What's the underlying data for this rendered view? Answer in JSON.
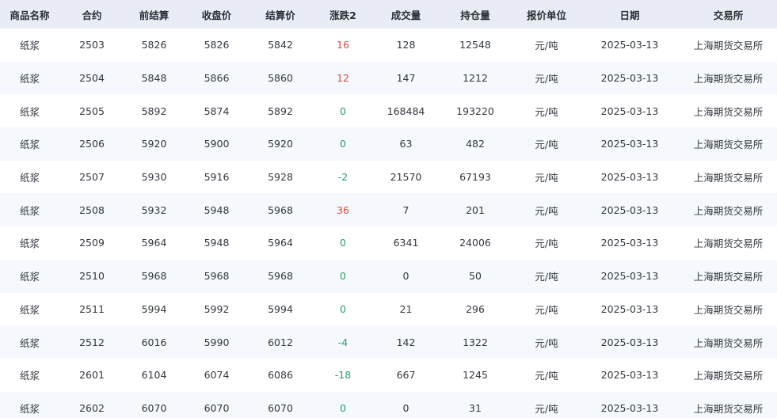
{
  "table": {
    "headers": [
      "商品名称",
      "合约",
      "前结算",
      "收盘价",
      "结算价",
      "涨跌2",
      "成交量",
      "持仓量",
      "报价单位",
      "日期",
      "交易所"
    ],
    "rows": [
      [
        "纸浆",
        "2503",
        "5826",
        "5826",
        "5842",
        "16",
        "128",
        "12548",
        "元/吨",
        "2025-03-13",
        "上海期货交易所"
      ],
      [
        "纸浆",
        "2504",
        "5848",
        "5866",
        "5860",
        "12",
        "147",
        "1212",
        "元/吨",
        "2025-03-13",
        "上海期货交易所"
      ],
      [
        "纸浆",
        "2505",
        "5892",
        "5874",
        "5892",
        "0",
        "168484",
        "193220",
        "元/吨",
        "2025-03-13",
        "上海期货交易所"
      ],
      [
        "纸浆",
        "2506",
        "5920",
        "5900",
        "5920",
        "0",
        "63",
        "482",
        "元/吨",
        "2025-03-13",
        "上海期货交易所"
      ],
      [
        "纸浆",
        "2507",
        "5930",
        "5916",
        "5928",
        "-2",
        "21570",
        "67193",
        "元/吨",
        "2025-03-13",
        "上海期货交易所"
      ],
      [
        "纸浆",
        "2508",
        "5932",
        "5948",
        "5968",
        "36",
        "7",
        "201",
        "元/吨",
        "2025-03-13",
        "上海期货交易所"
      ],
      [
        "纸浆",
        "2509",
        "5964",
        "5948",
        "5964",
        "0",
        "6341",
        "24006",
        "元/吨",
        "2025-03-13",
        "上海期货交易所"
      ],
      [
        "纸浆",
        "2510",
        "5968",
        "5968",
        "5968",
        "0",
        "0",
        "50",
        "元/吨",
        "2025-03-13",
        "上海期货交易所"
      ],
      [
        "纸浆",
        "2511",
        "5994",
        "5992",
        "5994",
        "0",
        "21",
        "296",
        "元/吨",
        "2025-03-13",
        "上海期货交易所"
      ],
      [
        "纸浆",
        "2512",
        "6016",
        "5990",
        "6012",
        "-4",
        "142",
        "1322",
        "元/吨",
        "2025-03-13",
        "上海期货交易所"
      ],
      [
        "纸浆",
        "2601",
        "6104",
        "6074",
        "6086",
        "-18",
        "667",
        "1245",
        "元/吨",
        "2025-03-13",
        "上海期货交易所"
      ],
      [
        "纸浆",
        "2602",
        "6070",
        "6070",
        "6070",
        "0",
        "0",
        "31",
        "元/吨",
        "2025-03-13",
        "上海期货交易所"
      ]
    ]
  },
  "colors": {
    "header_bg": "#e9ecf4",
    "row_alt_bg": "#f5f8fc",
    "positive_change": "#e0463f",
    "zero_or_negative_change": "#2a9d6b"
  }
}
